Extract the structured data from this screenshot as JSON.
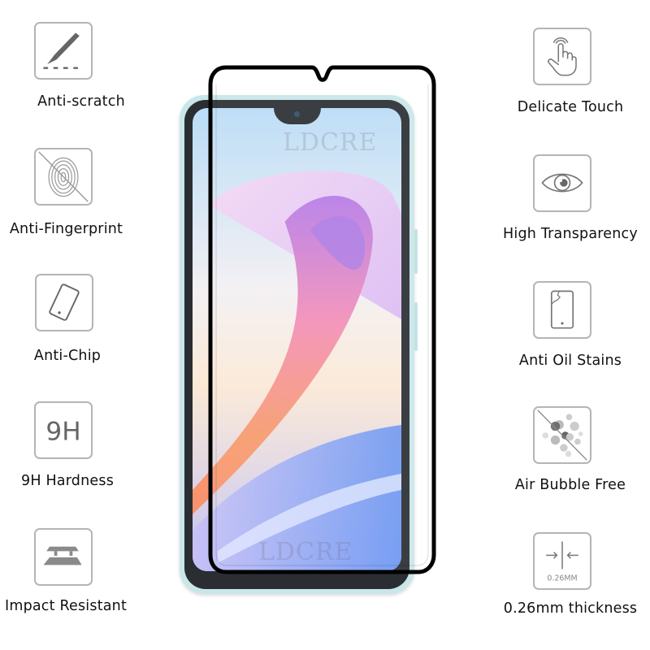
{
  "watermark": "LDCRE",
  "features_left": [
    {
      "label": "Anti-scratch",
      "icon": "scalpel-icon"
    },
    {
      "label": "Anti-Fingerprint",
      "icon": "fingerprint-crossed-icon"
    },
    {
      "label": "Anti-Chip",
      "icon": "tilted-phone-icon"
    },
    {
      "label": "9H Hardness",
      "icon": "9h-icon",
      "icon_text": "9H"
    },
    {
      "label": "Impact Resistant",
      "icon": "impact-layers-icon"
    }
  ],
  "features_right": [
    {
      "label": "Delicate Touch",
      "icon": "touch-hand-icon"
    },
    {
      "label": "High Transparency",
      "icon": "eye-icon"
    },
    {
      "label": "Anti Oil Stains",
      "icon": "cracked-phone-icon"
    },
    {
      "label": "Air Bubble Free",
      "icon": "bubbles-crossed-icon"
    },
    {
      "label": "0.26mm thickness",
      "icon": "thickness-icon",
      "icon_text": "0.26MM"
    }
  ],
  "colors": {
    "icon_stroke": "#b5b5b5",
    "icon_fill": "#6b6b6b",
    "text": "#111111",
    "glass_edge": "#000000",
    "phone_frame": "#c9e6e9"
  }
}
